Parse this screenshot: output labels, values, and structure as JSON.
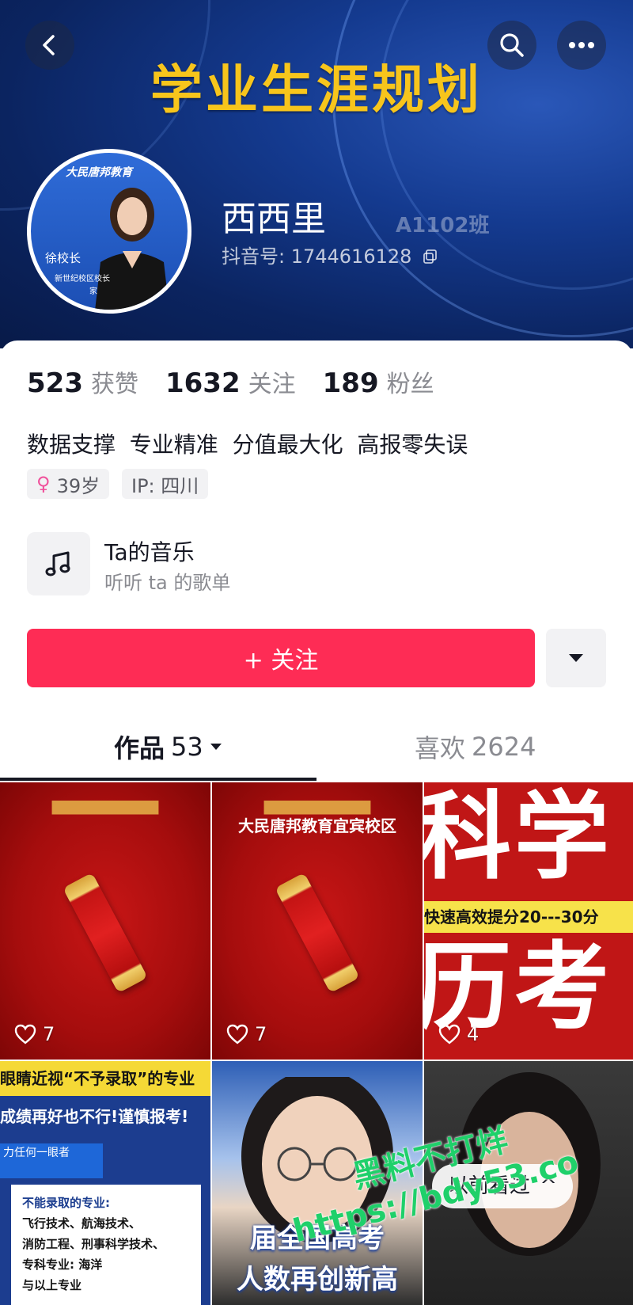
{
  "header": {
    "banner_title": "学业生涯规划",
    "avatar_badge": "大民唐邦教育",
    "avatar_name": "徐校长",
    "avatar_caption": "新世纪校区校长",
    "avatar_caption2": "家",
    "nickname": "西西里",
    "class_watermark": "A1102班",
    "douyin_id": "抖音号: 1744616128",
    "back_icon": "back-arrow-icon",
    "search_icon": "search-icon",
    "more_icon": "more-dots-icon"
  },
  "stats": [
    {
      "value": "523",
      "label": "获赞"
    },
    {
      "value": "1632",
      "label": "关注"
    },
    {
      "value": "189",
      "label": "粉丝"
    }
  ],
  "bio": "数据支撑  专业精准  分值最大化  高报零失误",
  "tags": {
    "age": "39岁",
    "ip": "IP: 四川"
  },
  "music": {
    "title": "Ta的音乐",
    "subtitle": "听听 ta 的歌单"
  },
  "follow_label": "+ 关注",
  "tabs": {
    "works_label": "作品",
    "works_count": "53",
    "likes_label": "喜欢",
    "likes_count": "2624"
  },
  "videos": [
    {
      "likes": "7",
      "caption": ""
    },
    {
      "likes": "7",
      "caption": "大民唐邦教育宜宾校区"
    },
    {
      "likes": "4",
      "big1": "科学",
      "band": "快速高效提分20---30分",
      "big2": "历考"
    },
    {
      "headline1": "眼睛近视“不予录取”的专业",
      "headline2": "成绩再好也不行!谨慎报考!",
      "side": "力任何一眼者",
      "list_title": "不能录取的专业:",
      "list1": "飞行技术、航海技术、",
      "list2": "消防工程、刑事科学技术、",
      "list3": "专科专业: 海洋",
      "list4": "与以上专业"
    },
    {
      "text1": "届全国高考",
      "text2": "人数再创新高"
    },
    {
      "pill": "以前看过"
    }
  ],
  "watermark": {
    "line1": "黑料不打烊",
    "line2": "https://bdy53.co"
  },
  "colors": {
    "accent": "#fe2c55",
    "banner": "#0b2460",
    "title_gold": "#f7c51c"
  }
}
